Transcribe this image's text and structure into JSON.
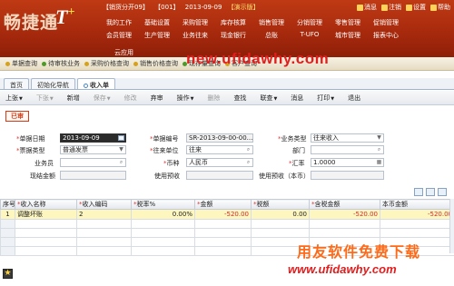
{
  "header": {
    "logo_text": "畅捷通",
    "logo_t": "T",
    "logo_plus": "+",
    "info": [
      "【销货分开09】",
      "【001】",
      "2013-09-09",
      "【演示版】"
    ],
    "links": [
      "消息",
      "注销",
      "设置",
      "帮助"
    ],
    "menu": [
      "我的工作",
      "基础设置",
      "采购管理",
      "库存核算",
      "销售管理",
      "分销管理",
      "零售管理",
      "促销管理",
      "",
      "会员管理",
      "生产管理",
      "业务往来",
      "现金银行",
      "总账",
      "T-UFO",
      "城市管理",
      "报表中心",
      ""
    ],
    "menu_row3": "云应用"
  },
  "quickbar": [
    "单据查询",
    "待审核业务",
    "采购价格查询",
    "销售价格查询",
    "现存量查询",
    "客户查询"
  ],
  "tabs": [
    "首页",
    "初始化导航",
    "收入单"
  ],
  "toolbar": [
    "上张",
    "下张",
    "新增",
    "保存",
    "修改",
    "弃审",
    "操作",
    "删除",
    "查找",
    "联查",
    "消息",
    "打印",
    "退出"
  ],
  "stamp": "已审",
  "form": {
    "doc_date_label": "单据日期",
    "doc_date": "2013-09-09",
    "doc_no_label": "单据编号",
    "doc_no": "SR-2013-09-00-00...",
    "biz_type_label": "业务类型",
    "biz_type": "往来收入",
    "invoice_type_label": "票据类型",
    "invoice_type": "普通发票",
    "partner_label": "往来单位",
    "partner": "往来",
    "dept_label": "部门",
    "dept": "",
    "salesman_label": "业务员",
    "salesman": "",
    "currency_label": "币种",
    "currency": "人民币",
    "rate_label": "汇率",
    "rate": "1.0000",
    "tax_amt_label": "现结金额",
    "prepay_label": "使用预收",
    "prepay_local_label": "使用预收（本币）"
  },
  "grid": {
    "columns": [
      "序号",
      "收入名称",
      "收入编码",
      "税率%",
      "金额",
      "税额",
      "含税金额",
      "本币金额"
    ],
    "rows": [
      [
        "1",
        "调整坏账",
        "2",
        "0.00%",
        "-520.00",
        "0.00",
        "-520.00",
        "-520.00"
      ],
      [
        "",
        "",
        "",
        "",
        "",
        "",
        "",
        ""
      ],
      [
        "",
        "",
        "",
        "",
        "",
        "",
        "",
        ""
      ],
      [
        "",
        "",
        "",
        "",
        "",
        "",
        "",
        ""
      ],
      [
        "",
        "",
        "",
        "",
        "",
        "",
        "",
        ""
      ]
    ]
  },
  "watermark": {
    "top_url": "new.ufidawhy.com",
    "cn": "用友软件免费下载",
    "url": "www.ufidawhy.com"
  },
  "colors": {
    "header_red": "#a82a0d",
    "stamp_red": "#d23c16",
    "negative": "#d42a2a",
    "selected_row": "#fdf6bf"
  }
}
